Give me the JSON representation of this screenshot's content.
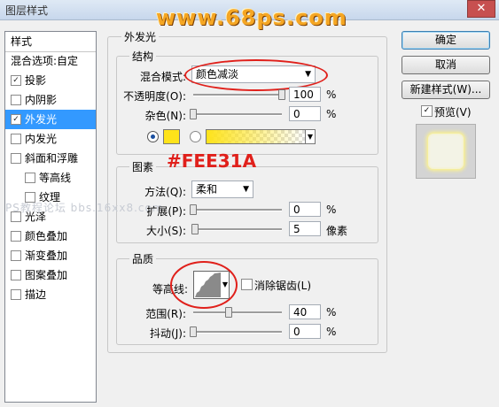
{
  "window": {
    "title": "图层样式",
    "close_glyph": "✕"
  },
  "watermark": "www.68ps.com",
  "left_panel": {
    "header": "样式",
    "items": [
      {
        "label": "混合选项:自定",
        "checkbox": false,
        "checked": false,
        "selected": false,
        "indent": false
      },
      {
        "label": "投影",
        "checkbox": true,
        "checked": true,
        "selected": false,
        "indent": false
      },
      {
        "label": "内阴影",
        "checkbox": true,
        "checked": false,
        "selected": false,
        "indent": false
      },
      {
        "label": "外发光",
        "checkbox": true,
        "checked": true,
        "selected": true,
        "indent": false
      },
      {
        "label": "内发光",
        "checkbox": true,
        "checked": false,
        "selected": false,
        "indent": false
      },
      {
        "label": "斜面和浮雕",
        "checkbox": true,
        "checked": false,
        "selected": false,
        "indent": false
      },
      {
        "label": "等高线",
        "checkbox": true,
        "checked": false,
        "selected": false,
        "indent": true
      },
      {
        "label": "纹理",
        "checkbox": true,
        "checked": false,
        "selected": false,
        "indent": true
      },
      {
        "label": "光泽",
        "checkbox": true,
        "checked": false,
        "selected": false,
        "indent": false
      },
      {
        "label": "颜色叠加",
        "checkbox": true,
        "checked": false,
        "selected": false,
        "indent": false
      },
      {
        "label": "渐变叠加",
        "checkbox": true,
        "checked": false,
        "selected": false,
        "indent": false
      },
      {
        "label": "图案叠加",
        "checkbox": true,
        "checked": false,
        "selected": false,
        "indent": false
      },
      {
        "label": "描边",
        "checkbox": true,
        "checked": false,
        "selected": false,
        "indent": false
      }
    ],
    "check_glyph": "✓"
  },
  "outer_glow": {
    "title": "外发光",
    "structure": {
      "title": "结构",
      "blend_mode_label": "混合模式:",
      "blend_mode_value": "颜色减淡",
      "opacity_label": "不透明度(O):",
      "opacity_value": "100",
      "opacity_level": 1.0,
      "noise_label": "杂色(N):",
      "noise_value": "0",
      "noise_level": 0.0,
      "percent": "%",
      "glow_color": "#FEE31A"
    },
    "elements": {
      "title": "图素",
      "method_label": "方法(Q):",
      "method_value": "柔和",
      "spread_label": "扩展(P):",
      "spread_value": "0",
      "spread_level": 0.0,
      "size_label": "大小(S):",
      "size_value": "5",
      "size_level": 0.02,
      "size_unit": "像素",
      "percent": "%"
    },
    "quality": {
      "title": "品质",
      "contour_label": "等高线:",
      "anti_alias_label": "消除锯齿(L)",
      "anti_alias_checked": false,
      "range_label": "范围(R):",
      "range_value": "40",
      "range_level": 0.4,
      "jitter_label": "抖动(J):",
      "jitter_value": "0",
      "jitter_level": 0.0,
      "percent": "%"
    }
  },
  "annotation": {
    "color_label": "#FEE31A"
  },
  "faint_url": "PS教程论坛 bbs.16xx8.com",
  "buttons": {
    "ok": "确定",
    "cancel": "取消",
    "new_style": "新建样式(W)...",
    "preview_label": "预览(V)",
    "preview_checked": true
  },
  "colors": {
    "accent": "#3399ff",
    "highlight": "#e0201b",
    "glow": "#FEE31A"
  }
}
